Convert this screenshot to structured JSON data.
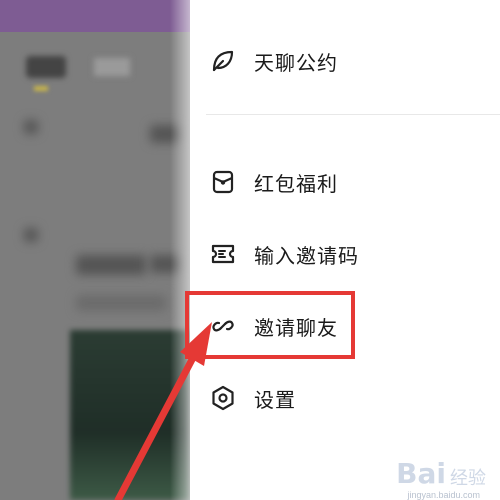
{
  "menu": {
    "items": [
      {
        "label": "天聊公约",
        "icon": "leaf-icon"
      },
      {
        "label": "红包福利",
        "icon": "red-envelope-icon"
      },
      {
        "label": "输入邀请码",
        "icon": "ticket-icon"
      },
      {
        "label": "邀请聊友",
        "icon": "link-icon"
      },
      {
        "label": "设置",
        "icon": "hexagon-settings-icon"
      }
    ]
  },
  "annotation": {
    "color": "#e53935"
  },
  "watermark": {
    "brand": "Bai",
    "sub": "经验",
    "url": "jingyan.baidu.com"
  }
}
